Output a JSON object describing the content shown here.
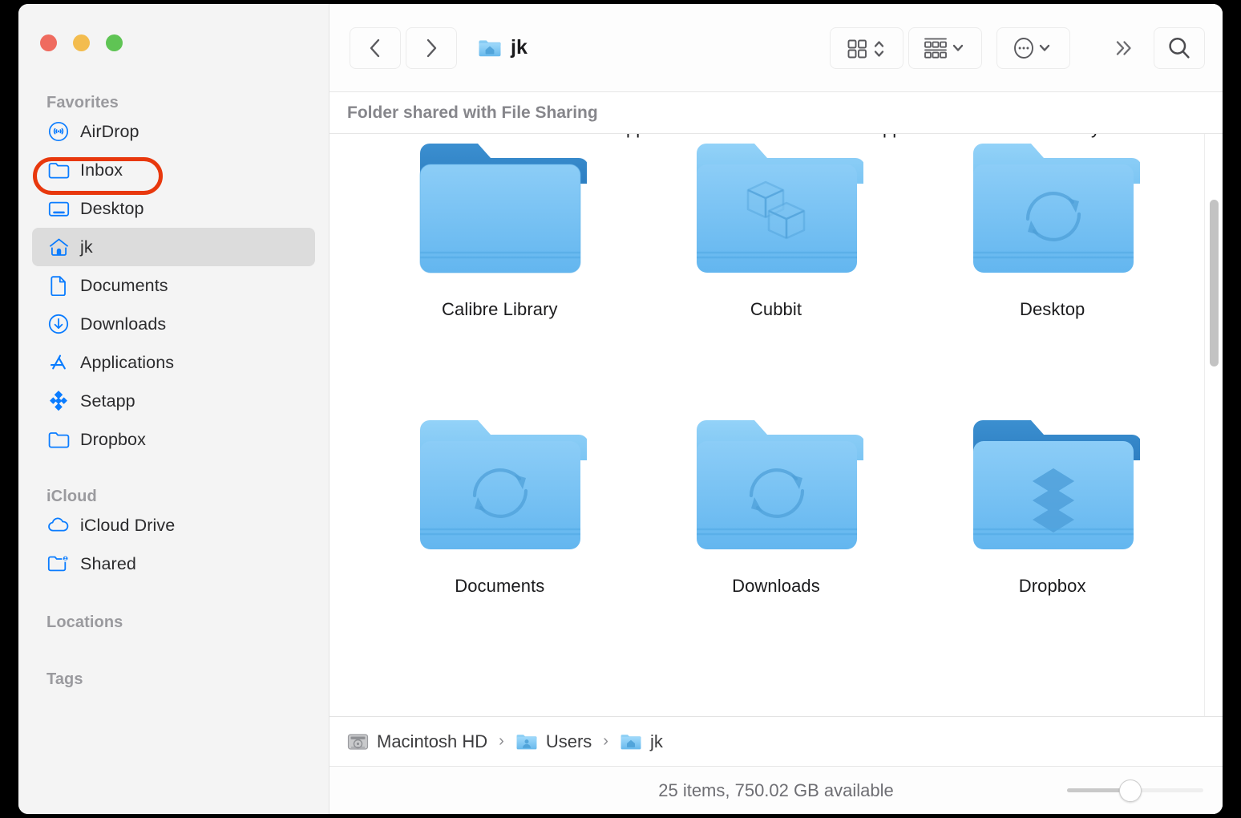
{
  "window": {
    "traffic_lights": [
      {
        "name": "close",
        "color": "#ef6b5f"
      },
      {
        "name": "minimize",
        "color": "#f3bc4e"
      },
      {
        "name": "zoom",
        "color": "#5fc454"
      }
    ]
  },
  "sidebar": {
    "sections": [
      {
        "title": "Favorites",
        "items": [
          {
            "label": "AirDrop",
            "icon": "airdrop-icon",
            "selected": false,
            "highlighted": false
          },
          {
            "label": "Inbox",
            "icon": "folder-icon",
            "selected": false,
            "highlighted": true
          },
          {
            "label": "Desktop",
            "icon": "display-icon",
            "selected": false,
            "highlighted": false
          },
          {
            "label": "jk",
            "icon": "home-icon",
            "selected": true,
            "highlighted": false
          },
          {
            "label": "Documents",
            "icon": "document-icon",
            "selected": false,
            "highlighted": false
          },
          {
            "label": "Downloads",
            "icon": "download-circle-icon",
            "selected": false,
            "highlighted": false
          },
          {
            "label": "Applications",
            "icon": "app-store-icon",
            "selected": false,
            "highlighted": false
          },
          {
            "label": "Setapp",
            "icon": "setapp-icon",
            "selected": false,
            "highlighted": false
          },
          {
            "label": "Dropbox",
            "icon": "folder-icon",
            "selected": false,
            "highlighted": false
          }
        ]
      },
      {
        "title": "iCloud",
        "items": [
          {
            "label": "iCloud Drive",
            "icon": "cloud-icon",
            "selected": false,
            "highlighted": false
          },
          {
            "label": "Shared",
            "icon": "shared-folder-icon",
            "selected": false,
            "highlighted": false
          }
        ]
      },
      {
        "title": "Locations",
        "items": []
      },
      {
        "title": "Tags",
        "items": []
      }
    ],
    "annotation_color": "#e8380d"
  },
  "toolbar": {
    "back_label": "Back",
    "forward_label": "Forward",
    "title": "jk",
    "title_icon": "home-folder-icon",
    "view_button": "icon-view-button",
    "group_button": "group-by-button",
    "action_button": "action-menu-button",
    "more_button": "more-toolbar-items-button",
    "search_button": "search-button"
  },
  "banner": {
    "text": "Folder shared with File Sharing"
  },
  "content": {
    "items": [
      {
        "name": "Calibre Library",
        "icon": "plain-folder-dark-tab"
      },
      {
        "name": "Cubbit",
        "icon": "cubbit-folder"
      },
      {
        "name": "Desktop",
        "icon": "sync-folder"
      },
      {
        "name": "Documents",
        "icon": "sync-folder"
      },
      {
        "name": "Downloads",
        "icon": "sync-folder"
      },
      {
        "name": "Dropbox",
        "icon": "dropbox-folder"
      }
    ]
  },
  "pathbar": {
    "crumbs": [
      {
        "label": "Macintosh HD",
        "icon": "hard-drive-icon"
      },
      {
        "label": "Users",
        "icon": "users-folder-icon"
      },
      {
        "label": "jk",
        "icon": "home-folder-icon"
      }
    ],
    "separator": "›"
  },
  "statusbar": {
    "text": "25 items, 750.02 GB available",
    "zoom_slider_value": 40
  }
}
